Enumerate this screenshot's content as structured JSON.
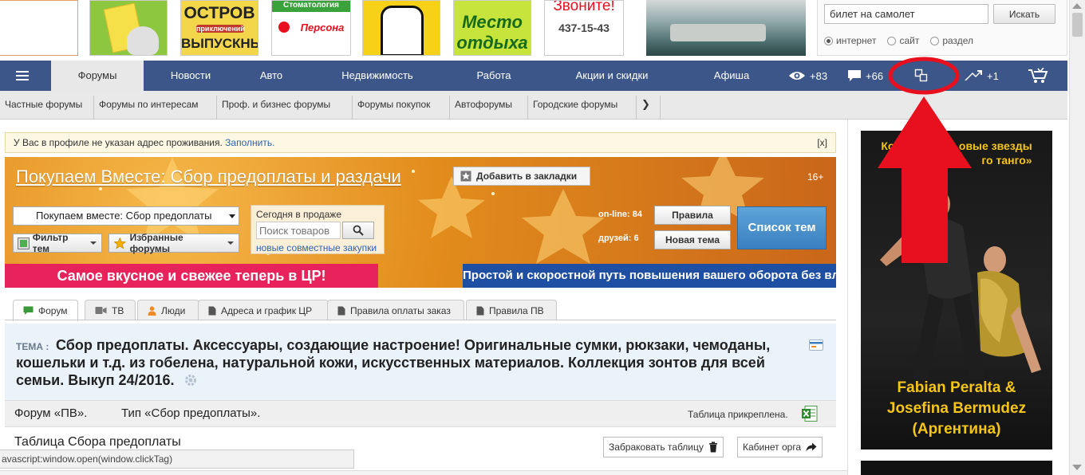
{
  "banners": [
    {
      "id": "b1",
      "text": "",
      "bg": "#ffffff"
    },
    {
      "id": "b2",
      "text": "",
      "bg": "#8dc63f"
    },
    {
      "id": "b3",
      "line1": "ОСТРОВ",
      "line2": "приключений",
      "line3": "ВЫПУСКНЫЕ",
      "bg": "#f3d64a"
    },
    {
      "id": "b4",
      "line1": "Стоматология",
      "line2": "Персона",
      "bg": "#ffffff"
    },
    {
      "id": "b5",
      "text": "",
      "bg": "#f7d117"
    },
    {
      "id": "b6",
      "line1": "Место",
      "line2": "отдыха",
      "bg": "#c6e43b"
    },
    {
      "id": "b7",
      "line1": "Звоните!",
      "line2": "437-15-43",
      "bg": "#ffffff"
    },
    {
      "id": "b8",
      "text": "",
      "bg": "#5f8a92"
    }
  ],
  "search": {
    "value": "билет на самолет",
    "button": "Искать",
    "options": [
      "интернет",
      "сайт",
      "раздел"
    ]
  },
  "nav": {
    "items": [
      "Форумы",
      "Новости",
      "Авто",
      "Недвижимость",
      "Работа",
      "Акции и скидки",
      "Афиша"
    ],
    "views": "+83",
    "comments": "+66",
    "karma": "+1"
  },
  "subnav": [
    "Частные форумы",
    "Форумы по интересам",
    "Проф. и бизнес форумы",
    "Форумы покупок",
    "Автофорумы",
    "Городские форумы"
  ],
  "notice": {
    "text": "У Вас в профиле не указан адрес проживания.",
    "link": "Заполнить.",
    "close": "[x]"
  },
  "forum": {
    "title": "Покупаем Вместе: Сбор предоплаты и раздачи",
    "bookmark": "Добавить в закладки",
    "age": "16+",
    "select": "Покупаем вместе: Сбор предоплаты",
    "filter": "Фильтр тем",
    "favorites": "Избранные форумы",
    "today_label": "Сегодня в продаже",
    "product_search_placeholder": "Поиск товаров",
    "joint_link": "новые совместные закупки",
    "online_label": "on-line:",
    "online": "84",
    "friends_label": "друзей:",
    "friends": "6",
    "rules": "Правила",
    "new_topic": "Новая тема",
    "topics": "Список тем",
    "promo_left": "Самое вкусное и свежее теперь в ЦР!",
    "promo_right": "Простой и скоростной путь повышения вашего оборота без вложений!"
  },
  "tabs": [
    "Форум",
    "ТВ",
    "Люди",
    "Адреса и график ЦР",
    "Правила оплаты заказ",
    "Правила ПВ"
  ],
  "topic": {
    "prefix": "ТЕМА :",
    "text": "Сбор предоплаты. Аксессуары, создающие настроение! Оригинальные сумки, рюкзаки, чемоданы, кошельки и т.д. из гобелена, натуральной кожи, искусственных материалов. Коллекция зонтов для всей семьи. Выкуп 24/2016."
  },
  "info": {
    "forum": "Форум «ПВ».",
    "type": "Тип «Сбор предоплаты».",
    "attached": "Таблица прикреплена."
  },
  "table": {
    "title": "Таблица Сбора предоплаты",
    "reject": "Забраковать таблицу",
    "cabinet": "Кабинет орга"
  },
  "status_bar": "avascript:window.open(window.clickTag)",
  "ad": {
    "top_line1": "Кон",
    "top_line1_end": "овые звезды",
    "top_line2_end": "го танго»",
    "names_line1": "Fabian Peralta &",
    "names_line2": "Josefina Bermudez",
    "names_line3": "(Аргентина)"
  },
  "colors": {
    "nav": "#3c5689",
    "annotation": "#e8101f",
    "accent_link": "#2d62b0"
  }
}
